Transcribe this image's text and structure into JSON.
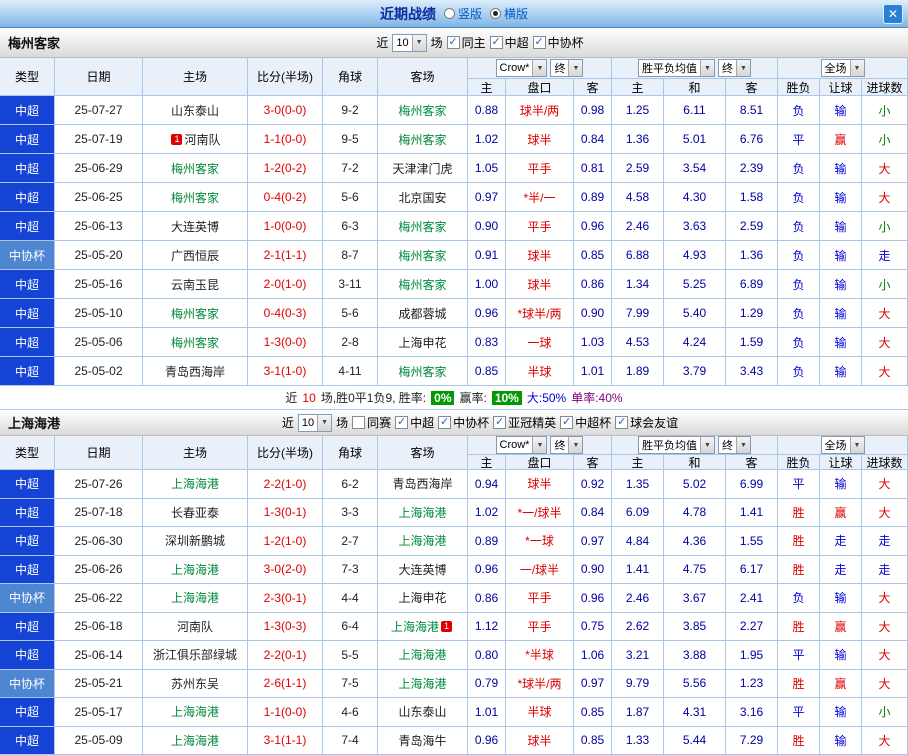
{
  "badges": {
    "red_card": "1"
  },
  "topbar": {
    "title": "近期战绩",
    "radio_vertical": "竖版",
    "radio_horizontal": "横版",
    "close_icon": "✕"
  },
  "sections": [
    {
      "team": "梅州客家",
      "controls": {
        "near_label": "近",
        "count": "10",
        "games_label": "场",
        "checkboxes": [
          {
            "label": "同主",
            "checked": true
          },
          {
            "label": "中超",
            "checked": true
          },
          {
            "label": "中协杯",
            "checked": true
          }
        ]
      },
      "header": {
        "type": "类型",
        "date": "日期",
        "home": "主场",
        "score": "比分(半场)",
        "corner": "角球",
        "away": "客场",
        "odds_source": "Crow*",
        "odds_final": "终",
        "odds_home": "主",
        "odds_handicap": "盘口",
        "odds_away": "客",
        "avg_source": "胜平负均值",
        "avg_final": "终",
        "avg_home": "主",
        "avg_draw": "和",
        "avg_away": "客",
        "scope": "全场",
        "result": "胜负",
        "handicap_result": "让球",
        "goals": "进球数"
      },
      "rows": [
        {
          "league": "中超",
          "date": "25-07-27",
          "home": "山东泰山",
          "score": "3-0(0-0)",
          "corner": "9-2",
          "away": "梅州客家",
          "odds_home": "0.88",
          "handicap": "球半/两",
          "odds_away": "0.98",
          "avg_home": "1.25",
          "avg_draw": "6.11",
          "avg_away": "8.51",
          "result": "负",
          "handicap_result": "输",
          "goals": "小"
        },
        {
          "league": "中超",
          "date": "25-07-19",
          "home": "河南队",
          "home_badge": "before",
          "score": "1-1(0-0)",
          "corner": "9-5",
          "away": "梅州客家",
          "odds_home": "1.02",
          "handicap": "球半",
          "odds_away": "0.84",
          "avg_home": "1.36",
          "avg_draw": "5.01",
          "avg_away": "6.76",
          "result": "平",
          "handicap_result": "赢",
          "goals": "小"
        },
        {
          "league": "中超",
          "date": "25-06-29",
          "home": "梅州客家",
          "score": "1-2(0-2)",
          "corner": "7-2",
          "away": "天津津门虎",
          "odds_home": "1.05",
          "handicap": "平手",
          "odds_away": "0.81",
          "avg_home": "2.59",
          "avg_draw": "3.54",
          "avg_away": "2.39",
          "result": "负",
          "handicap_result": "输",
          "goals": "大"
        },
        {
          "league": "中超",
          "date": "25-06-25",
          "home": "梅州客家",
          "score": "0-4(0-2)",
          "corner": "5-6",
          "away": "北京国安",
          "odds_home": "0.97",
          "handicap": "*半/一",
          "odds_away": "0.89",
          "avg_home": "4.58",
          "avg_draw": "4.30",
          "avg_away": "1.58",
          "result": "负",
          "handicap_result": "输",
          "goals": "大"
        },
        {
          "league": "中超",
          "date": "25-06-13",
          "home": "大连英博",
          "score": "1-0(0-0)",
          "corner": "6-3",
          "away": "梅州客家",
          "odds_home": "0.90",
          "handicap": "平手",
          "odds_away": "0.96",
          "avg_home": "2.46",
          "avg_draw": "3.63",
          "avg_away": "2.59",
          "result": "负",
          "handicap_result": "输",
          "goals": "小"
        },
        {
          "league": "中协杯",
          "date": "25-05-20",
          "home": "广西恒辰",
          "score": "2-1(1-1)",
          "corner": "8-7",
          "away": "梅州客家",
          "odds_home": "0.91",
          "handicap": "球半",
          "odds_away": "0.85",
          "avg_home": "6.88",
          "avg_draw": "4.93",
          "avg_away": "1.36",
          "result": "负",
          "handicap_result": "输",
          "goals": "走"
        },
        {
          "league": "中超",
          "date": "25-05-16",
          "home": "云南玉昆",
          "score": "2-0(1-0)",
          "corner": "3-11",
          "away": "梅州客家",
          "odds_home": "1.00",
          "handicap": "球半",
          "odds_away": "0.86",
          "avg_home": "1.34",
          "avg_draw": "5.25",
          "avg_away": "6.89",
          "result": "负",
          "handicap_result": "输",
          "goals": "小"
        },
        {
          "league": "中超",
          "date": "25-05-10",
          "home": "梅州客家",
          "score": "0-4(0-3)",
          "corner": "5-6",
          "away": "成都蓉城",
          "odds_home": "0.96",
          "handicap": "*球半/两",
          "odds_away": "0.90",
          "avg_home": "7.99",
          "avg_draw": "5.40",
          "avg_away": "1.29",
          "result": "负",
          "handicap_result": "输",
          "goals": "大"
        },
        {
          "league": "中超",
          "date": "25-05-06",
          "home": "梅州客家",
          "score": "1-3(0-0)",
          "corner": "2-8",
          "away": "上海申花",
          "odds_home": "0.83",
          "handicap": "一球",
          "odds_away": "1.03",
          "avg_home": "4.53",
          "avg_draw": "4.24",
          "avg_away": "1.59",
          "result": "负",
          "handicap_result": "输",
          "goals": "大"
        },
        {
          "league": "中超",
          "date": "25-05-02",
          "home": "青岛西海岸",
          "score": "3-1(1-0)",
          "corner": "4-11",
          "away": "梅州客家",
          "odds_home": "0.85",
          "handicap": "半球",
          "odds_away": "1.01",
          "avg_home": "1.89",
          "avg_draw": "3.79",
          "avg_away": "3.43",
          "result": "负",
          "handicap_result": "输",
          "goals": "大"
        }
      ],
      "summary": {
        "near": "近",
        "games": "10",
        "rest": "场,胜0平1负9, 胜率:",
        "win_rate": "0%",
        "earn_label": "赢率:",
        "earn_rate": "10%",
        "big_rate": "大:50%",
        "single_rate": "单率:40%"
      }
    },
    {
      "team": "上海海港",
      "controls": {
        "near_label": "近",
        "count": "10",
        "games_label": "场",
        "checkboxes": [
          {
            "label": "同赛",
            "checked": false
          },
          {
            "label": "中超",
            "checked": true
          },
          {
            "label": "中协杯",
            "checked": true
          },
          {
            "label": "亚冠精英",
            "checked": true
          },
          {
            "label": "中超杯",
            "checked": true
          },
          {
            "label": "球会友谊",
            "checked": true
          }
        ]
      },
      "header": {
        "type": "类型",
        "date": "日期",
        "home": "主场",
        "score": "比分(半场)",
        "corner": "角球",
        "away": "客场",
        "odds_source": "Crow*",
        "odds_final": "终",
        "odds_home": "主",
        "odds_handicap": "盘口",
        "odds_away": "客",
        "avg_source": "胜平负均值",
        "avg_final": "终",
        "avg_home": "主",
        "avg_draw": "和",
        "avg_away": "客",
        "scope": "全场",
        "result": "胜负",
        "handicap_result": "让球",
        "goals": "进球数"
      },
      "rows": [
        {
          "league": "中超",
          "date": "25-07-26",
          "home": "上海海港",
          "score": "2-2(1-0)",
          "corner": "6-2",
          "away": "青岛西海岸",
          "odds_home": "0.94",
          "handicap": "球半",
          "odds_away": "0.92",
          "avg_home": "1.35",
          "avg_draw": "5.02",
          "avg_away": "6.99",
          "result": "平",
          "handicap_result": "输",
          "goals": "大"
        },
        {
          "league": "中超",
          "date": "25-07-18",
          "home": "长春亚泰",
          "score": "1-3(0-1)",
          "corner": "3-3",
          "away": "上海海港",
          "odds_home": "1.02",
          "handicap": "*一/球半",
          "odds_away": "0.84",
          "avg_home": "6.09",
          "avg_draw": "4.78",
          "avg_away": "1.41",
          "result": "胜",
          "handicap_result": "赢",
          "goals": "大"
        },
        {
          "league": "中超",
          "date": "25-06-30",
          "home": "深圳新鹏城",
          "score": "1-2(1-0)",
          "corner": "2-7",
          "away": "上海海港",
          "odds_home": "0.89",
          "handicap": "*一球",
          "odds_away": "0.97",
          "avg_home": "4.84",
          "avg_draw": "4.36",
          "avg_away": "1.55",
          "result": "胜",
          "handicap_result": "走",
          "goals": "走"
        },
        {
          "league": "中超",
          "date": "25-06-26",
          "home": "上海海港",
          "score": "3-0(2-0)",
          "corner": "7-3",
          "away": "大连英博",
          "odds_home": "0.96",
          "handicap": "一/球半",
          "odds_away": "0.90",
          "avg_home": "1.41",
          "avg_draw": "4.75",
          "avg_away": "6.17",
          "result": "胜",
          "handicap_result": "走",
          "goals": "走"
        },
        {
          "league": "中协杯",
          "date": "25-06-22",
          "home": "上海海港",
          "score": "2-3(0-1)",
          "corner": "4-4",
          "away": "上海申花",
          "odds_home": "0.86",
          "handicap": "平手",
          "odds_away": "0.96",
          "avg_home": "2.46",
          "avg_draw": "3.67",
          "avg_away": "2.41",
          "result": "负",
          "handicap_result": "输",
          "goals": "大"
        },
        {
          "league": "中超",
          "date": "25-06-18",
          "home": "河南队",
          "score": "1-3(0-3)",
          "corner": "6-4",
          "away": "上海海港",
          "away_badge": "after",
          "odds_home": "1.12",
          "handicap": "平手",
          "odds_away": "0.75",
          "avg_home": "2.62",
          "avg_draw": "3.85",
          "avg_away": "2.27",
          "result": "胜",
          "handicap_result": "赢",
          "goals": "大"
        },
        {
          "league": "中超",
          "date": "25-06-14",
          "home": "浙江俱乐部绿城",
          "score": "2-2(0-1)",
          "corner": "5-5",
          "away": "上海海港",
          "odds_home": "0.80",
          "handicap": "*半球",
          "odds_away": "1.06",
          "avg_home": "3.21",
          "avg_draw": "3.88",
          "avg_away": "1.95",
          "result": "平",
          "handicap_result": "输",
          "goals": "大"
        },
        {
          "league": "中协杯",
          "date": "25-05-21",
          "home": "苏州东吴",
          "score": "2-6(1-1)",
          "corner": "7-5",
          "away": "上海海港",
          "odds_home": "0.79",
          "handicap": "*球半/两",
          "odds_away": "0.97",
          "avg_home": "9.79",
          "avg_draw": "5.56",
          "avg_away": "1.23",
          "result": "胜",
          "handicap_result": "赢",
          "goals": "大"
        },
        {
          "league": "中超",
          "date": "25-05-17",
          "home": "上海海港",
          "score": "1-1(0-0)",
          "corner": "4-6",
          "away": "山东泰山",
          "odds_home": "1.01",
          "handicap": "半球",
          "odds_away": "0.85",
          "avg_home": "1.87",
          "avg_draw": "4.31",
          "avg_away": "3.16",
          "result": "平",
          "handicap_result": "输",
          "goals": "小"
        },
        {
          "league": "中超",
          "date": "25-05-09",
          "home": "上海海港",
          "score": "3-1(1-1)",
          "corner": "7-4",
          "away": "青岛海牛",
          "odds_home": "0.96",
          "handicap": "球半",
          "odds_away": "0.85",
          "avg_home": "1.33",
          "avg_draw": "5.44",
          "avg_away": "7.29",
          "result": "胜",
          "handicap_result": "输",
          "goals": "大"
        }
      ]
    }
  ]
}
